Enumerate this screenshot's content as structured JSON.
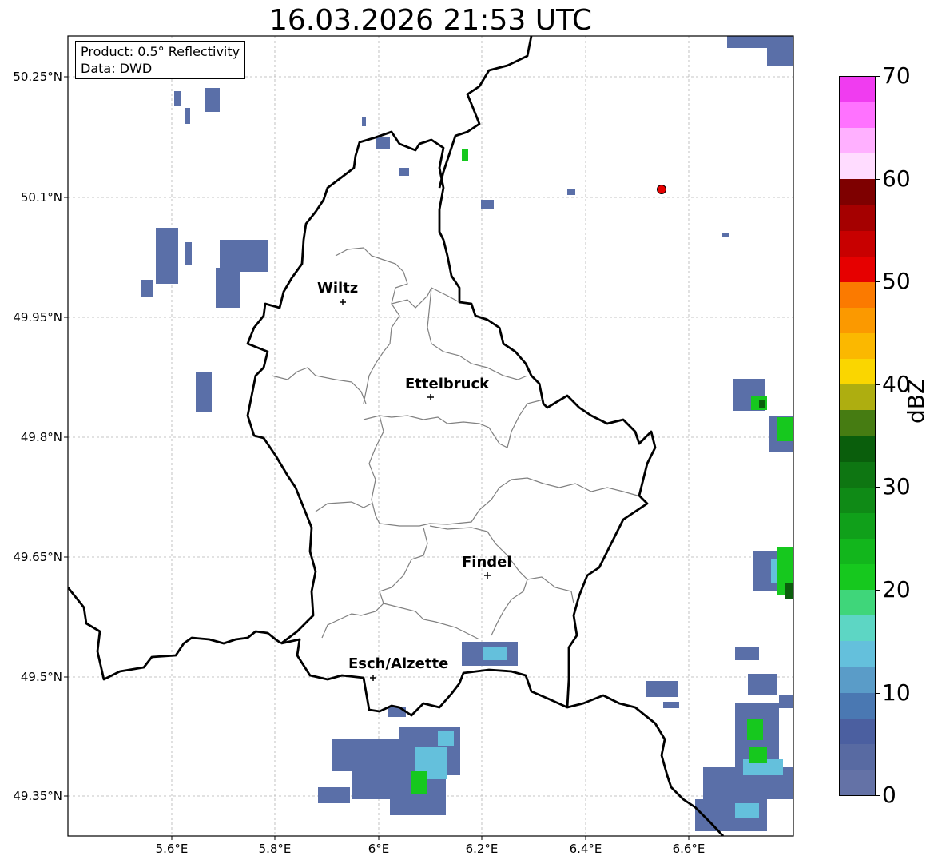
{
  "title": "16.03.2026 21:53 UTC",
  "info": {
    "product": "Product: 0.5° Reflectivity",
    "data": "Data: DWD"
  },
  "lat_labels": [
    "50.25°N",
    "50.1°N",
    "49.95°N",
    "49.8°N",
    "49.65°N",
    "49.5°N",
    "49.35°N"
  ],
  "lon_labels": [
    "5.6°E",
    "5.8°E",
    "6°E",
    "6.2°E",
    "6.4°E",
    "6.6°E"
  ],
  "cities": [
    {
      "id": "wiltz",
      "name": "Wiltz"
    },
    {
      "id": "ettelbruck",
      "name": "Ettelbruck"
    },
    {
      "id": "findel",
      "name": "Findel"
    },
    {
      "id": "esch",
      "name": "Esch/Alzette"
    }
  ],
  "colorbar": {
    "label": "dBZ",
    "ticks": [
      "0",
      "10",
      "20",
      "30",
      "40",
      "50",
      "60",
      "70"
    ],
    "colors": [
      "#6472a6",
      "#586aa2",
      "#4b5fa0",
      "#4a78b2",
      "#5a9cc8",
      "#64c0dc",
      "#5dd6c4",
      "#3fd67a",
      "#16c81e",
      "#12b61c",
      "#10a01a",
      "#0f8a16",
      "#0e7612",
      "#0a5e0c",
      "#467c12",
      "#aeae10",
      "#fad600",
      "#fbb800",
      "#fb9900",
      "#fb7a00",
      "#e60000",
      "#c80000",
      "#a50000",
      "#7e0000",
      "#ffdcff",
      "#ffb0ff",
      "#ff72ff",
      "#f03cf0"
    ]
  },
  "colors": {
    "border_national": "#000000",
    "border_canton": "#808080",
    "grid": "#b4b4b4",
    "marker": "#e60000"
  }
}
